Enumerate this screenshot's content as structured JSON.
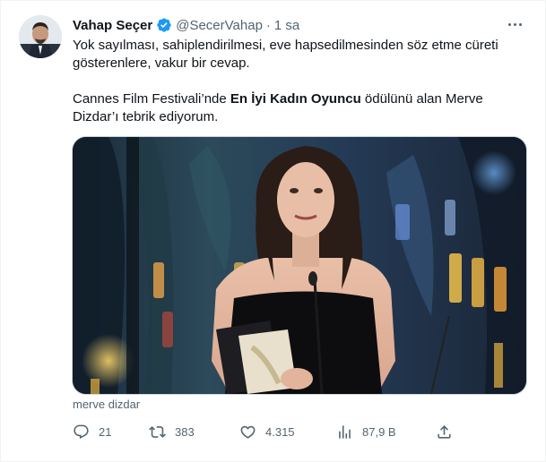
{
  "author": {
    "name": "Vahap Seçer",
    "handle": "@SecerVahap",
    "time": "1 sa",
    "dot": "·"
  },
  "tweet": {
    "line1": "Yok sayılması, sahiplendirilmesi, eve hapsedilmesinden söz etme cüreti gösterenlere, vakur bir cevap.",
    "line2_pre": "Cannes Film Festivali’nde ",
    "line2_bold": "En İyi Kadın Oyuncu",
    "line2_post": " ödülünü alan Merve Dizdar’ı tebrik ediyorum."
  },
  "media": {
    "credit": "merve dizdar"
  },
  "actions": {
    "replies": "21",
    "retweets": "383",
    "likes": "4.315",
    "views": "87,9 B"
  },
  "colors": {
    "text": "#0f1419",
    "secondary": "#536471",
    "verified": "#1d9bf0"
  }
}
